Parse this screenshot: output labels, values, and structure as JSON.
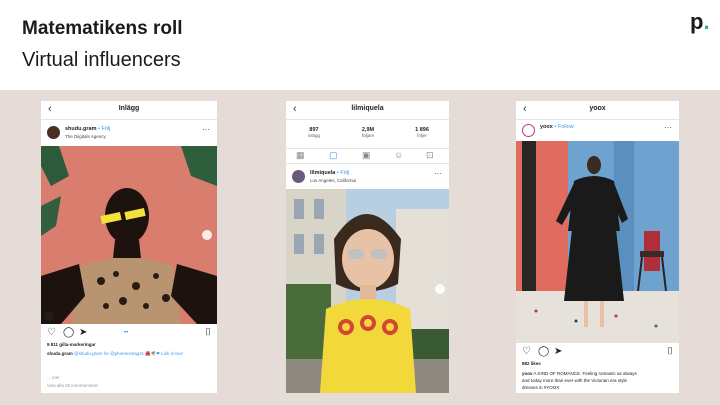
{
  "slide": {
    "title": "Matematikens roll",
    "subtitle": "Virtual influencers",
    "logo": "p",
    "logo_dot": "."
  },
  "phone1": {
    "header": "Inlägg",
    "username": "shudu.gram",
    "follow": "• Följ",
    "subtitle": "The Diigitals Agency",
    "likes": "9 811 gilla-markeringar",
    "caption_user": "shudu.gram",
    "caption_text": "@shudu.gram for @phoenixmagzk 🌺🌴❤ Link in bio!",
    "more": "... mer",
    "comments": "Visa alla 26 kommentarer"
  },
  "phone2": {
    "header": "lilmiquela",
    "stats": [
      {
        "value": "897",
        "label": "inlägg"
      },
      {
        "value": "2,9M",
        "label": "följare"
      },
      {
        "value": "1 896",
        "label": "följer"
      }
    ],
    "username": "lilmiquela",
    "follow": "• Följ",
    "subtitle": "Los Angeles, California"
  },
  "phone3": {
    "header": "yoox",
    "username": "yoox",
    "follow": "• Follow",
    "likes": "882 likes",
    "caption_user": "yoox",
    "caption_text": "A KIND OF ROMANCE. Feeling romantic as always",
    "caption_line2": "and today more than ever with the Victorian era style",
    "caption_line3": "dresses in #YOOX"
  },
  "colors": {
    "band": "#e6dcd7",
    "logo_dot": "#2bb673",
    "follow_blue": "#3897f0"
  },
  "icons": [
    "back-chevron-icon",
    "more-dots-icon",
    "heart-icon",
    "comment-icon",
    "send-icon",
    "bookmark-icon",
    "grid-icon",
    "tv-icon",
    "tag-icon"
  ]
}
